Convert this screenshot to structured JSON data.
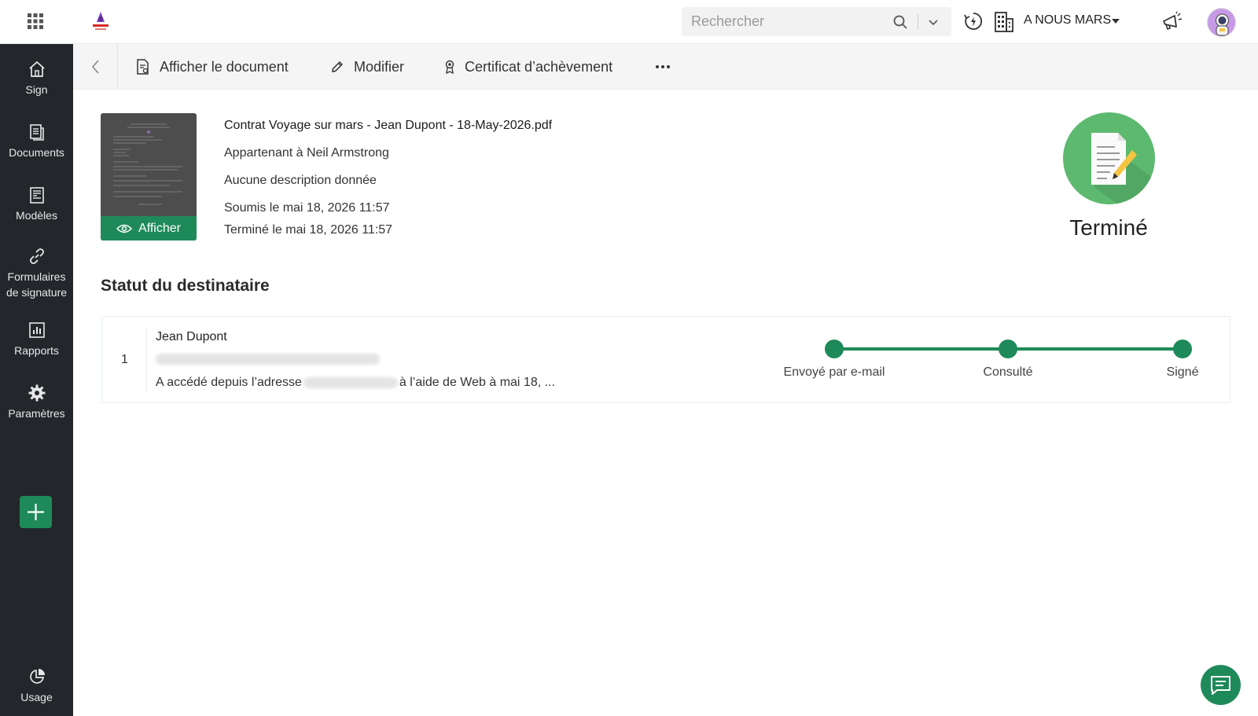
{
  "topbar": {
    "search_placeholder": "Rechercher",
    "org_name": "A NOUS MARS"
  },
  "sidebar": {
    "items": [
      {
        "label": "Sign",
        "icon": "home-icon"
      },
      {
        "label": "Documents",
        "icon": "documents-icon"
      },
      {
        "label": "Modèles",
        "icon": "templates-icon"
      },
      {
        "label": "Formulaires de signature",
        "icon": "link-icon"
      },
      {
        "label": "Rapports",
        "icon": "reports-icon"
      },
      {
        "label": "Paramètres",
        "icon": "gear-icon"
      },
      {
        "label": "Usage",
        "icon": "usage-icon"
      }
    ]
  },
  "toolbar": {
    "view_document": "Afficher le document",
    "edit": "Modifier",
    "certificate": "Certificat d’achèvement"
  },
  "document": {
    "view_label": "Afficher",
    "title": "Contrat Voyage sur mars - Jean Dupont - 18-May-2026.pdf",
    "owner": "Appartenant à Neil Armstrong",
    "description": "Aucune description donnée",
    "submitted": "Soumis le mai 18, 2026 11:57",
    "completed": "Terminé le mai 18, 2026 11:57",
    "status": "Terminé"
  },
  "recipients": {
    "section_title": "Statut du destinataire",
    "rows": [
      {
        "index": "1",
        "name": "Jean Dupont",
        "access_prefix": "A accédé depuis l’adresse",
        "access_suffix": "à l’aide de Web à mai 18, ..."
      }
    ],
    "timeline": [
      "Envoyé par e-mail",
      "Consulté",
      "Signé"
    ]
  },
  "colors": {
    "accent": "#1f8a59",
    "sidebar_bg": "#23272b",
    "status_circle": "#5cb96f"
  }
}
